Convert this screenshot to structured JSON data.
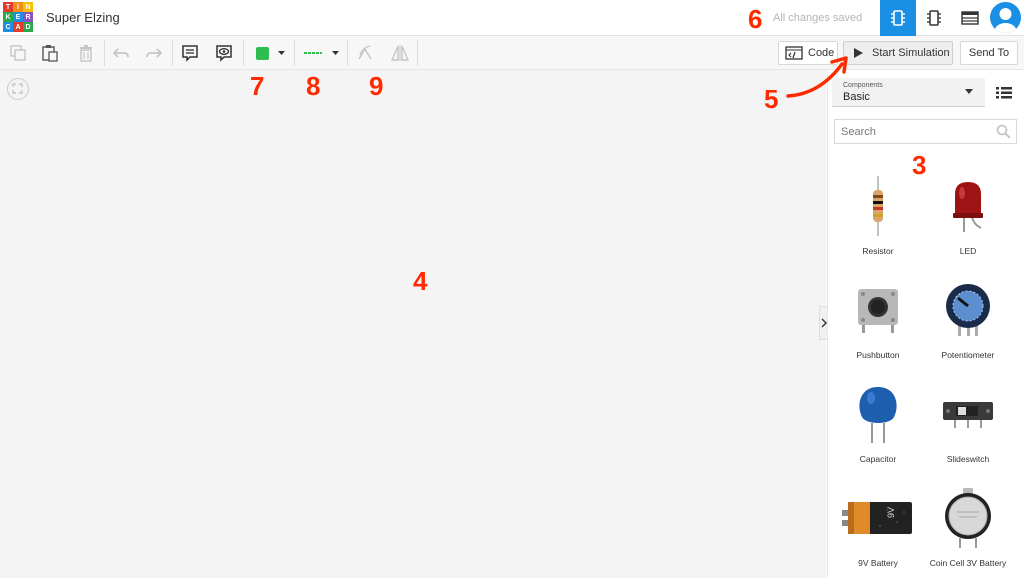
{
  "app": {
    "logo_letters": [
      "T",
      "I",
      "N",
      "K",
      "E",
      "R",
      "C",
      "A",
      "D"
    ],
    "logo_colors": [
      "#e23b2e",
      "#f28d1a",
      "#f5c000",
      "#2aa84a",
      "#1a8fe3",
      "#8b4fc6",
      "#1a8fe3",
      "#e23b2e",
      "#2aa84a"
    ],
    "title": "Super Elzing",
    "save_status": "All changes saved",
    "accent_color": "#1a8fe3"
  },
  "toolbar": {
    "code_label": "Code",
    "simulate_label": "Start Simulation",
    "send_label": "Send To",
    "wire_color": "#2ebd4f"
  },
  "panel": {
    "dropdown_caption": "Components",
    "dropdown_value": "Basic",
    "search_placeholder": "Search",
    "components": [
      {
        "label": "Resistor",
        "icon": "resistor-icon"
      },
      {
        "label": "LED",
        "icon": "led-icon"
      },
      {
        "label": "Pushbutton",
        "icon": "pushbutton-icon"
      },
      {
        "label": "Potentiometer",
        "icon": "potentiometer-icon"
      },
      {
        "label": "Capacitor",
        "icon": "capacitor-icon"
      },
      {
        "label": "Slideswitch",
        "icon": "slideswitch-icon"
      },
      {
        "label": "9V Battery",
        "icon": "battery-9v-icon"
      },
      {
        "label": "Coin Cell 3V Battery",
        "icon": "coin-cell-icon"
      }
    ],
    "battery_text": "9V"
  },
  "annotations": [
    "3",
    "4",
    "5",
    "6",
    "7",
    "8",
    "9"
  ],
  "annotation_color": "#ff2a00"
}
